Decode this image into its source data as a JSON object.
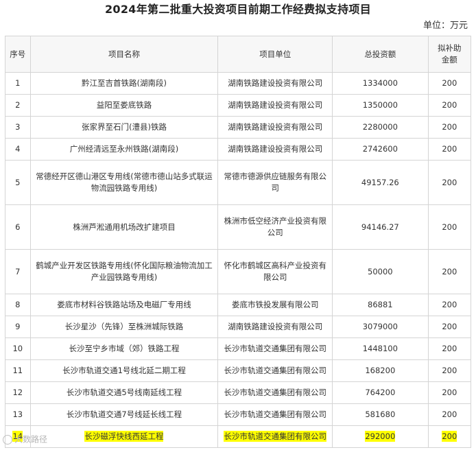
{
  "title": "2024年第二批重大投资项目前期工作经费拟支持项目",
  "unit_label": "单位：万元",
  "headers": {
    "no": "序号",
    "name": "项目名称",
    "unit": "项目单位",
    "total": "总投资额",
    "subsidy_line1": "拟补助",
    "subsidy_line2": "金额"
  },
  "rows": [
    {
      "no": "1",
      "name": "黔江至吉首铁路(湖南段)",
      "unit": "湖南铁路建设投资有限公司",
      "total": "1334000",
      "subsidy": "200"
    },
    {
      "no": "2",
      "name": "益阳至娄底铁路",
      "unit": "湖南铁路建设投资有限公司",
      "total": "1350000",
      "subsidy": "200"
    },
    {
      "no": "3",
      "name": "张家界至石门(澧县)铁路",
      "unit": "湖南铁路建设投资有限公司",
      "total": "2280000",
      "subsidy": "200"
    },
    {
      "no": "4",
      "name": "广州经清远至永州铁路(湖南段)",
      "unit": "湖南铁路建设投资有限公司",
      "total": "2742600",
      "subsidy": "200"
    },
    {
      "no": "5",
      "name": "常德经开区德山港区专用线(常德市德山站多式联运物流园铁路专用线)",
      "unit": "常德市德源供应链服务有限公司",
      "total": "49157.26",
      "subsidy": "200"
    },
    {
      "no": "6",
      "name": "株洲芦淞通用机场改扩建项目",
      "unit": "株洲市低空经济产业投资有限公司",
      "total": "94146.27",
      "subsidy": "200"
    },
    {
      "no": "7",
      "name": "鹤城产业开发区铁路专用线(怀化国际粮油物流加工产业园铁路专用线)",
      "unit": "怀化市鹤城区高科产业投资有限公司",
      "total": "50000",
      "subsidy": "200"
    },
    {
      "no": "8",
      "name": "娄底市材料谷铁路站场及电磁厂专用线",
      "unit": "娄底市铁投发展有限公司",
      "total": "86881",
      "subsidy": "200"
    },
    {
      "no": "9",
      "name": "长沙星沙（先锋）至株洲城际铁路",
      "unit": "湖南铁路建设投资有限公司",
      "total": "3079000",
      "subsidy": "200"
    },
    {
      "no": "10",
      "name": "长沙至宁乡市域（郊）铁路工程",
      "unit": "长沙市轨道交通集团有限公司",
      "total": "1448100",
      "subsidy": "200"
    },
    {
      "no": "11",
      "name": "长沙市轨道交通1号线北延二期工程",
      "unit": "长沙市轨道交通集团有限公司",
      "total": "168200",
      "subsidy": "200"
    },
    {
      "no": "12",
      "name": "长沙市轨道交通5号线南延线工程",
      "unit": "长沙市轨道交通集团有限公司",
      "total": "764200",
      "subsidy": "200"
    },
    {
      "no": "13",
      "name": "长沙市轨道交通7号线延长线工程",
      "unit": "长沙市轨道交通集团有限公司",
      "total": "581680",
      "subsidy": "200"
    },
    {
      "no": "14",
      "name": "长沙磁浮快线西延工程",
      "unit": "长沙市轨道交通集团有限公司",
      "total": "292000",
      "subsidy": "200"
    }
  ],
  "watermark": "大数路径",
  "colors": {
    "highlight": "#ffff00",
    "border": "#d4d4d4",
    "header_bg": "#f7f7f7"
  }
}
